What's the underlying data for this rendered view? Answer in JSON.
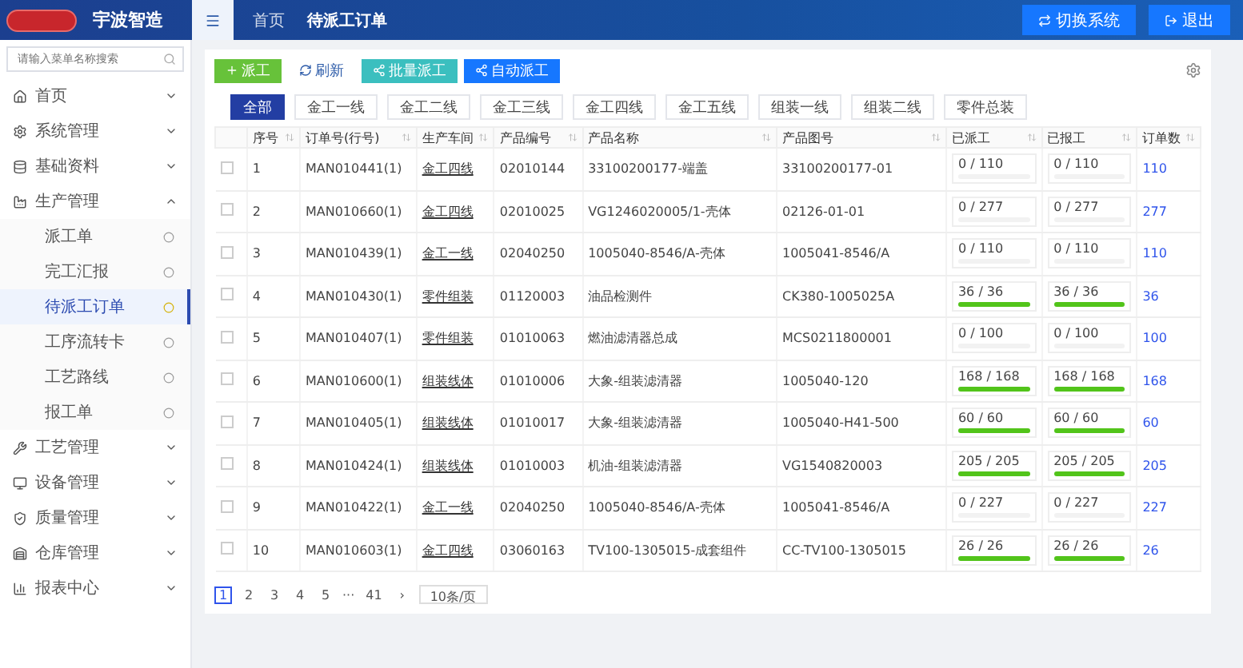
{
  "header": {
    "brand": "宇波智造",
    "tabs": [
      {
        "label": "首页",
        "selected": false
      },
      {
        "label": "待派工订单",
        "selected": true
      }
    ],
    "actions": [
      "切换系统",
      "退出"
    ]
  },
  "sidebar": {
    "search": {
      "placeholder": "请输入菜单名称搜索"
    },
    "items": [
      {
        "label": "首页",
        "expanded": false
      },
      {
        "label": "系统管理",
        "expanded": false
      },
      {
        "label": "基础资料",
        "expanded": false
      },
      {
        "label": "生产管理",
        "expanded": true,
        "children": [
          {
            "label": "派工单",
            "selected": false
          },
          {
            "label": "完工汇报",
            "selected": false
          },
          {
            "label": "待派工订单",
            "selected": true
          },
          {
            "label": "工序流转卡",
            "selected": false
          },
          {
            "label": "工艺路线",
            "selected": false
          },
          {
            "label": "报工单",
            "selected": false
          }
        ]
      },
      {
        "label": "工艺管理",
        "expanded": false
      },
      {
        "label": "设备管理",
        "expanded": false
      },
      {
        "label": "质量管理",
        "expanded": false
      },
      {
        "label": "仓库管理",
        "expanded": false
      },
      {
        "label": "报表中心",
        "expanded": false
      }
    ]
  },
  "toolbar": [
    {
      "label": "派工",
      "kind": "green"
    },
    {
      "label": "刷新",
      "kind": "plain"
    },
    {
      "label": "批量派工",
      "kind": "teal"
    },
    {
      "label": "自动派工",
      "kind": "blue"
    }
  ],
  "filters": [
    {
      "label": "全部",
      "selected": true
    },
    {
      "label": "金工一线",
      "selected": false
    },
    {
      "label": "金工二线",
      "selected": false
    },
    {
      "label": "金工三线",
      "selected": false
    },
    {
      "label": "金工四线",
      "selected": false
    },
    {
      "label": "金工五线",
      "selected": false
    },
    {
      "label": "组装一线",
      "selected": false
    },
    {
      "label": "组装二线",
      "selected": false
    },
    {
      "label": "零件总装",
      "selected": false
    }
  ],
  "table": {
    "columns": [
      "序号",
      "订单号(行号)",
      "生产车间",
      "产品编号",
      "产品名称",
      "产品图号",
      "已派工",
      "已报工",
      "订单数"
    ],
    "rows": [
      {
        "checked": false,
        "no": "1",
        "order": "MAN010441(1)",
        "workshop": "金工四线",
        "code": "02010144",
        "name": "33100200177-端盖",
        "drawing": "33100200177-01",
        "dispatched": {
          "text": "0 / 110",
          "level": 0
        },
        "reported": {
          "text": "0 / 110",
          "level": 0
        },
        "qty": "110"
      },
      {
        "checked": false,
        "no": "2",
        "order": "MAN010660(1)",
        "workshop": "金工四线",
        "code": "02010025",
        "name": "VG1246020005/1-壳体",
        "drawing": "02126-01-01",
        "dispatched": {
          "text": "0 / 277",
          "level": 0
        },
        "reported": {
          "text": "0 / 277",
          "level": 0
        },
        "qty": "277"
      },
      {
        "checked": false,
        "no": "3",
        "order": "MAN010439(1)",
        "workshop": "金工一线",
        "code": "02040250",
        "name": "1005040-8546/A-壳体",
        "drawing": "1005041-8546/A",
        "dispatched": {
          "text": "0 / 110",
          "level": 0
        },
        "reported": {
          "text": "0 / 110",
          "level": 0
        },
        "qty": "110"
      },
      {
        "checked": false,
        "no": "4",
        "order": "MAN010430(1)",
        "workshop": "零件组装",
        "code": "01120003",
        "name": "油品检测件",
        "drawing": "CK380-1005025A",
        "dispatched": {
          "text": "36 / 36",
          "level": 1
        },
        "reported": {
          "text": "36 / 36",
          "level": 1
        },
        "qty": "36"
      },
      {
        "checked": false,
        "no": "5",
        "order": "MAN010407(1)",
        "workshop": "零件组装",
        "code": "01010063",
        "name": "燃油滤清器总成",
        "drawing": "MCS0211800001",
        "dispatched": {
          "text": "0 / 100",
          "level": 0
        },
        "reported": {
          "text": "0 / 100",
          "level": 0
        },
        "qty": "100"
      },
      {
        "checked": false,
        "no": "6",
        "order": "MAN010600(1)",
        "workshop": "组装线体",
        "code": "01010006",
        "name": "大象-组装滤清器",
        "drawing": "1005040-120",
        "dispatched": {
          "text": "168 / 168",
          "level": 1
        },
        "reported": {
          "text": "168 / 168",
          "level": 1
        },
        "qty": "168"
      },
      {
        "checked": false,
        "no": "7",
        "order": "MAN010405(1)",
        "workshop": "组装线体",
        "code": "01010017",
        "name": "大象-组装滤清器",
        "drawing": "1005040-H41-500",
        "dispatched": {
          "text": "60 / 60",
          "level": 1
        },
        "reported": {
          "text": "60 / 60",
          "level": 1
        },
        "qty": "60"
      },
      {
        "checked": false,
        "no": "8",
        "order": "MAN010424(1)",
        "workshop": "组装线体",
        "code": "01010003",
        "name": "机油-组装滤清器",
        "drawing": "VG1540820003",
        "dispatched": {
          "text": "205 / 205",
          "level": 1
        },
        "reported": {
          "text": "205 / 205",
          "level": 1
        },
        "qty": "205"
      },
      {
        "checked": false,
        "no": "9",
        "order": "MAN010422(1)",
        "workshop": "金工一线",
        "code": "02040250",
        "name": "1005040-8546/A-壳体",
        "drawing": "1005041-8546/A",
        "dispatched": {
          "text": "0 / 227",
          "level": 0
        },
        "reported": {
          "text": "0 / 227",
          "level": 0
        },
        "qty": "227"
      },
      {
        "checked": false,
        "no": "10",
        "order": "MAN010603(1)",
        "workshop": "金工四线",
        "code": "03060163",
        "name": "TV100-1305015-成套组件",
        "drawing": "CC-TV100-1305015",
        "dispatched": {
          "text": "26 / 26",
          "level": 1
        },
        "reported": {
          "text": "26 / 26",
          "level": 1
        },
        "qty": "26"
      }
    ]
  },
  "pagination": {
    "pages": [
      {
        "label": "1",
        "selected": true
      },
      {
        "label": "2",
        "selected": false
      },
      {
        "label": "3",
        "selected": false
      },
      {
        "label": "4",
        "selected": false
      },
      {
        "label": "5",
        "selected": false
      }
    ],
    "ellipsis": "···",
    "last": "41",
    "next": "›",
    "size": "10条/页"
  }
}
